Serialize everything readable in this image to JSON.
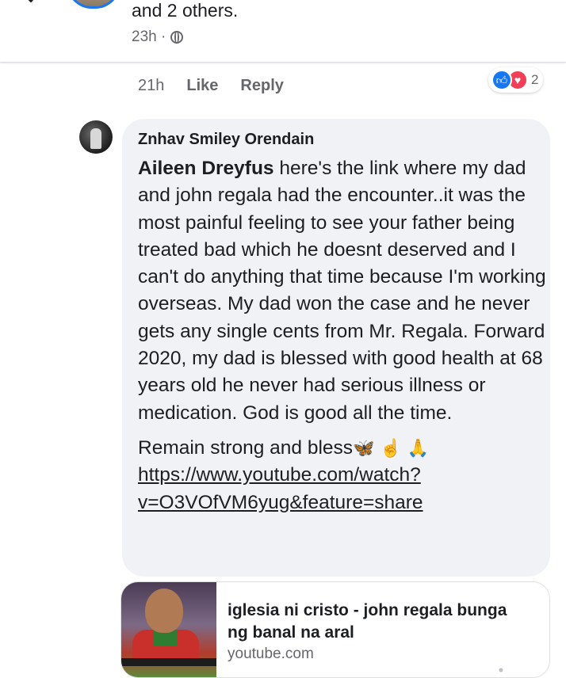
{
  "previous_post": {
    "text": "and 2 others.",
    "time": "23h ·"
  },
  "previous_comment_actions": {
    "time": "21h",
    "like_label": "Like",
    "reply_label": "Reply",
    "reaction_count": "2",
    "reaction_icons": [
      "like-icon",
      "love-icon"
    ]
  },
  "comment": {
    "author": "Znhav Smiley Orendain",
    "mention": "Aileen Dreyfus",
    "body": " here's the link where my dad and john regala had the encounter..it was the most painful feeling to see your father being treated bad which he doesnt deserved and I can't do anything that time because I'm working overseas. My dad won the case and he never gets any single cents from Mr. Regala. Forward 2020, my dad is blessed with good health at 68 years old he never had serious illness or medication. God is good all the time.",
    "closing": "Remain strong and bless",
    "emojis": [
      "🦋",
      "☝",
      "🙏"
    ],
    "link": "https://www.youtube.com/watch?v=O3VOfVM6yug&feature=share"
  },
  "link_preview": {
    "title": "iglesia ni cristo - john regala bunga ng banal na aral",
    "domain": "youtube.com"
  },
  "colors": {
    "bubble": "#f0f2f5",
    "like": "#1877f2",
    "love": "#f33e58",
    "secondary_text": "#65676b"
  }
}
